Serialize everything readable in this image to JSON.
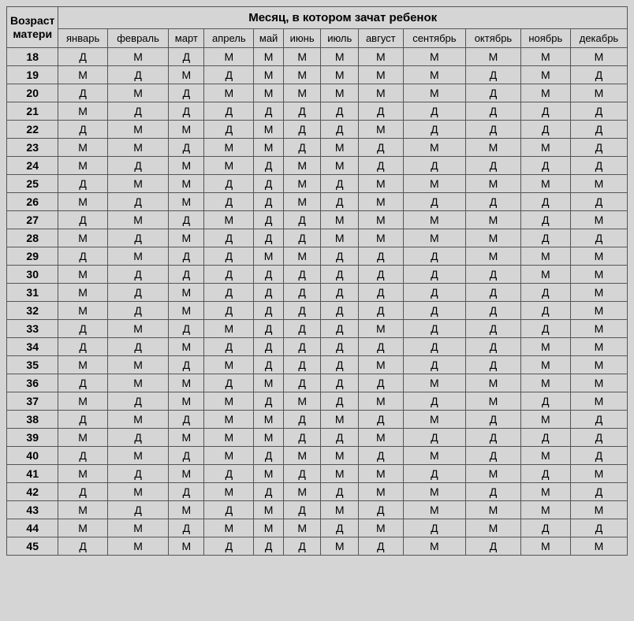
{
  "chart_data": {
    "type": "table",
    "title": "Месяц, в котором зачат ребенок",
    "row_header": "Возраст матери",
    "columns": [
      "январь",
      "февраль",
      "март",
      "апрель",
      "май",
      "июнь",
      "июль",
      "август",
      "сентябрь",
      "октябрь",
      "ноябрь",
      "декабрь"
    ],
    "rows": [
      {
        "age": "18",
        "values": [
          "Д",
          "М",
          "Д",
          "М",
          "М",
          "М",
          "М",
          "М",
          "М",
          "М",
          "М",
          "М"
        ]
      },
      {
        "age": "19",
        "values": [
          "М",
          "Д",
          "М",
          "Д",
          "М",
          "М",
          "М",
          "М",
          "М",
          "Д",
          "М",
          "Д"
        ]
      },
      {
        "age": "20",
        "values": [
          "Д",
          "М",
          "Д",
          "М",
          "М",
          "М",
          "М",
          "М",
          "М",
          "Д",
          "М",
          "М"
        ]
      },
      {
        "age": "21",
        "values": [
          "М",
          "Д",
          "Д",
          "Д",
          "Д",
          "Д",
          "Д",
          "Д",
          "Д",
          "Д",
          "Д",
          "Д"
        ]
      },
      {
        "age": "22",
        "values": [
          "Д",
          "М",
          "М",
          "Д",
          "М",
          "Д",
          "Д",
          "М",
          "Д",
          "Д",
          "Д",
          "Д"
        ]
      },
      {
        "age": "23",
        "values": [
          "М",
          "М",
          "Д",
          "М",
          "М",
          "Д",
          "М",
          "Д",
          "М",
          "М",
          "М",
          "Д"
        ]
      },
      {
        "age": "24",
        "values": [
          "М",
          "Д",
          "М",
          "М",
          "Д",
          "М",
          "М",
          "Д",
          "Д",
          "Д",
          "Д",
          "Д"
        ]
      },
      {
        "age": "25",
        "values": [
          "Д",
          "М",
          "М",
          "Д",
          "Д",
          "М",
          "Д",
          "М",
          "М",
          "М",
          "М",
          "М"
        ]
      },
      {
        "age": "26",
        "values": [
          "М",
          "Д",
          "М",
          "Д",
          "Д",
          "М",
          "Д",
          "М",
          "Д",
          "Д",
          "Д",
          "Д"
        ]
      },
      {
        "age": "27",
        "values": [
          "Д",
          "М",
          "Д",
          "М",
          "Д",
          "Д",
          "М",
          "М",
          "М",
          "М",
          "Д",
          "М"
        ]
      },
      {
        "age": "28",
        "values": [
          "М",
          "Д",
          "М",
          "Д",
          "Д",
          "Д",
          "М",
          "М",
          "М",
          "М",
          "Д",
          "Д"
        ]
      },
      {
        "age": "29",
        "values": [
          "Д",
          "М",
          "Д",
          "Д",
          "М",
          "М",
          "Д",
          "Д",
          "Д",
          "М",
          "М",
          "М"
        ]
      },
      {
        "age": "30",
        "values": [
          "М",
          "Д",
          "Д",
          "Д",
          "Д",
          "Д",
          "Д",
          "Д",
          "Д",
          "Д",
          "М",
          "М"
        ]
      },
      {
        "age": "31",
        "values": [
          "М",
          "Д",
          "М",
          "Д",
          "Д",
          "Д",
          "Д",
          "Д",
          "Д",
          "Д",
          "Д",
          "М"
        ]
      },
      {
        "age": "32",
        "values": [
          "М",
          "Д",
          "М",
          "Д",
          "Д",
          "Д",
          "Д",
          "Д",
          "Д",
          "Д",
          "Д",
          "М"
        ]
      },
      {
        "age": "33",
        "values": [
          "Д",
          "М",
          "Д",
          "М",
          "Д",
          "Д",
          "Д",
          "М",
          "Д",
          "Д",
          "Д",
          "М"
        ]
      },
      {
        "age": "34",
        "values": [
          "Д",
          "Д",
          "М",
          "Д",
          "Д",
          "Д",
          "Д",
          "Д",
          "Д",
          "Д",
          "М",
          "М"
        ]
      },
      {
        "age": "35",
        "values": [
          "М",
          "М",
          "Д",
          "М",
          "Д",
          "Д",
          "Д",
          "М",
          "Д",
          "Д",
          "М",
          "М"
        ]
      },
      {
        "age": "36",
        "values": [
          "Д",
          "М",
          "М",
          "Д",
          "М",
          "Д",
          "Д",
          "Д",
          "М",
          "М",
          "М",
          "М"
        ]
      },
      {
        "age": "37",
        "values": [
          "М",
          "Д",
          "М",
          "М",
          "Д",
          "М",
          "Д",
          "М",
          "Д",
          "М",
          "Д",
          "М"
        ]
      },
      {
        "age": "38",
        "values": [
          "Д",
          "М",
          "Д",
          "М",
          "М",
          "Д",
          "М",
          "Д",
          "М",
          "Д",
          "М",
          "Д"
        ]
      },
      {
        "age": "39",
        "values": [
          "М",
          "Д",
          "М",
          "М",
          "М",
          "Д",
          "Д",
          "М",
          "Д",
          "Д",
          "Д",
          "Д"
        ]
      },
      {
        "age": "40",
        "values": [
          "Д",
          "М",
          "Д",
          "М",
          "Д",
          "М",
          "М",
          "Д",
          "М",
          "Д",
          "М",
          "Д"
        ]
      },
      {
        "age": "41",
        "values": [
          "М",
          "Д",
          "М",
          "Д",
          "М",
          "Д",
          "М",
          "М",
          "Д",
          "М",
          "Д",
          "М"
        ]
      },
      {
        "age": "42",
        "values": [
          "Д",
          "М",
          "Д",
          "М",
          "Д",
          "М",
          "Д",
          "М",
          "М",
          "Д",
          "М",
          "Д"
        ]
      },
      {
        "age": "43",
        "values": [
          "М",
          "Д",
          "М",
          "Д",
          "М",
          "Д",
          "М",
          "Д",
          "М",
          "М",
          "М",
          "М"
        ]
      },
      {
        "age": "44",
        "values": [
          "М",
          "М",
          "Д",
          "М",
          "М",
          "М",
          "Д",
          "М",
          "Д",
          "М",
          "Д",
          "Д"
        ]
      },
      {
        "age": "45",
        "values": [
          "Д",
          "М",
          "М",
          "Д",
          "Д",
          "Д",
          "М",
          "Д",
          "М",
          "Д",
          "М",
          "М"
        ]
      }
    ]
  }
}
